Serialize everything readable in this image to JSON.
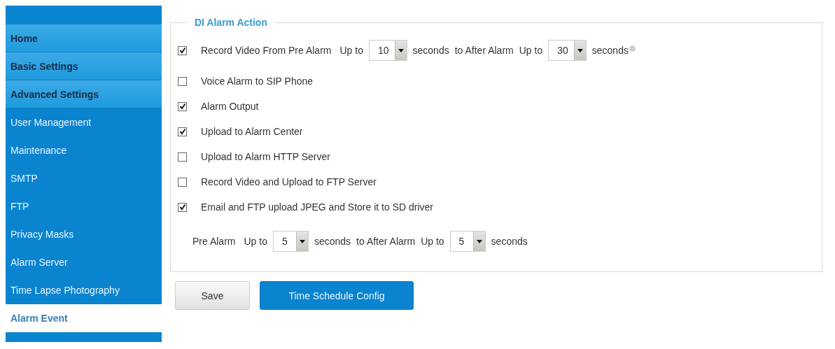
{
  "sidebar": {
    "items": [
      {
        "label": "Home",
        "kind": "section",
        "selected": false
      },
      {
        "label": "Basic Settings",
        "kind": "section",
        "selected": false
      },
      {
        "label": "Advanced Settings",
        "kind": "section",
        "selected": false
      },
      {
        "label": "User Management",
        "kind": "item",
        "selected": false
      },
      {
        "label": "Maintenance",
        "kind": "item",
        "selected": false
      },
      {
        "label": "SMTP",
        "kind": "item",
        "selected": false
      },
      {
        "label": "FTP",
        "kind": "item",
        "selected": false
      },
      {
        "label": "Privacy Masks",
        "kind": "item",
        "selected": false
      },
      {
        "label": "Alarm Server",
        "kind": "item",
        "selected": false
      },
      {
        "label": "Time Lapse Photography",
        "kind": "item",
        "selected": false
      },
      {
        "label": "Alarm Event",
        "kind": "item",
        "selected": true
      }
    ]
  },
  "panel": {
    "title": "DI Alarm Action",
    "rows": [
      {
        "kind": "checkbox",
        "checked": true,
        "label": "Record Video From Pre Alarm",
        "parts": [
          {
            "kind": "text",
            "text": "Up to"
          },
          {
            "kind": "select",
            "value": "10"
          },
          {
            "kind": "text",
            "text": "seconds"
          },
          {
            "kind": "text",
            "text": "to After Alarm"
          },
          {
            "kind": "text",
            "text": "Up to"
          },
          {
            "kind": "select",
            "value": "30"
          },
          {
            "kind": "text",
            "text": "seconds"
          },
          {
            "kind": "info"
          }
        ]
      },
      {
        "kind": "checkbox",
        "checked": false,
        "label": "Voice Alarm to SIP Phone"
      },
      {
        "kind": "checkbox",
        "checked": true,
        "label": "Alarm Output"
      },
      {
        "kind": "checkbox",
        "checked": true,
        "label": "Upload to Alarm Center"
      },
      {
        "kind": "checkbox",
        "checked": false,
        "label": "Upload to Alarm HTTP Server"
      },
      {
        "kind": "checkbox",
        "checked": false,
        "label": "Record Video and Upload to FTP Server"
      },
      {
        "kind": "checkbox",
        "checked": true,
        "label": "Email and FTP upload JPEG and Store it to SD driver"
      },
      {
        "kind": "timing",
        "label": "Pre Alarm",
        "parts": [
          {
            "kind": "text",
            "text": "Up to"
          },
          {
            "kind": "select",
            "value": "5"
          },
          {
            "kind": "text",
            "text": "seconds"
          },
          {
            "kind": "text",
            "text": "to After Alarm"
          },
          {
            "kind": "text",
            "text": "Up to"
          },
          {
            "kind": "select",
            "value": "5"
          },
          {
            "kind": "text",
            "text": "seconds"
          }
        ]
      }
    ]
  },
  "buttons": [
    {
      "label": "Save",
      "kind": "plain"
    },
    {
      "label": "Time Schedule Config",
      "kind": "primary"
    }
  ]
}
